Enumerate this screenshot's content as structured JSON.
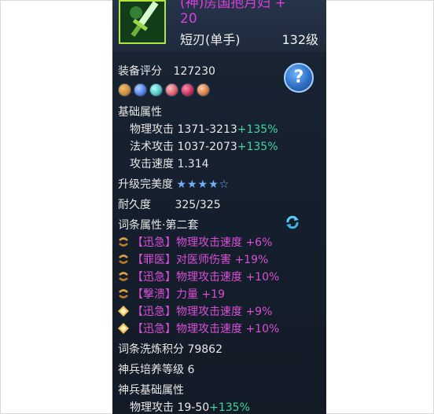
{
  "item": {
    "name_line1": "(神)房国抱月妇 +",
    "name_line2": "20",
    "type": "短刃(单手)",
    "level": "132级"
  },
  "score": {
    "label": "装备评分",
    "value": "127230"
  },
  "help_label": "?",
  "gems": [
    "#c58a3a",
    "#4a7fe0",
    "#4fc0c0",
    "#d85a6a",
    "#c82a5a",
    "#d07a4a"
  ],
  "basic": {
    "title": "基础属性",
    "phys_label": "物理攻击",
    "phys_value": "1371-3213",
    "phys_bonus": "+135%",
    "magic_label": "法术攻击",
    "magic_value": "1037-2073",
    "magic_bonus": "+135%",
    "speed_label": "攻击速度",
    "speed_value": "1.314"
  },
  "perfection": {
    "label": "升级完美度",
    "stars": "★★★★☆"
  },
  "durability": {
    "label": "耐久度",
    "value": "325/325"
  },
  "affixes": {
    "title": "词条属性·第二套",
    "items": [
      "【迅急】物理攻击速度 +6%",
      "【罪医】对医师伤害 +19%",
      "【迅急】物理攻击速度 +10%",
      "【撃溃】力量 +19",
      "【迅急】物理攻击速度 +9%",
      "【迅急】物理攻击速度 +10%"
    ]
  },
  "refine_score": {
    "label": "词条洗炼积分",
    "value": "79862"
  },
  "cultivation": {
    "label": "神兵培养等级",
    "value": "6"
  },
  "shenbing": {
    "title": "神兵基础属性",
    "phys_label": "物理攻击",
    "phys_value": "19-50",
    "phys_bonus": "+135%"
  },
  "colors": {
    "accent_green": "#3fd6a0",
    "affix_pink": "#d84fd6",
    "name_purple": "#d93fd8"
  }
}
